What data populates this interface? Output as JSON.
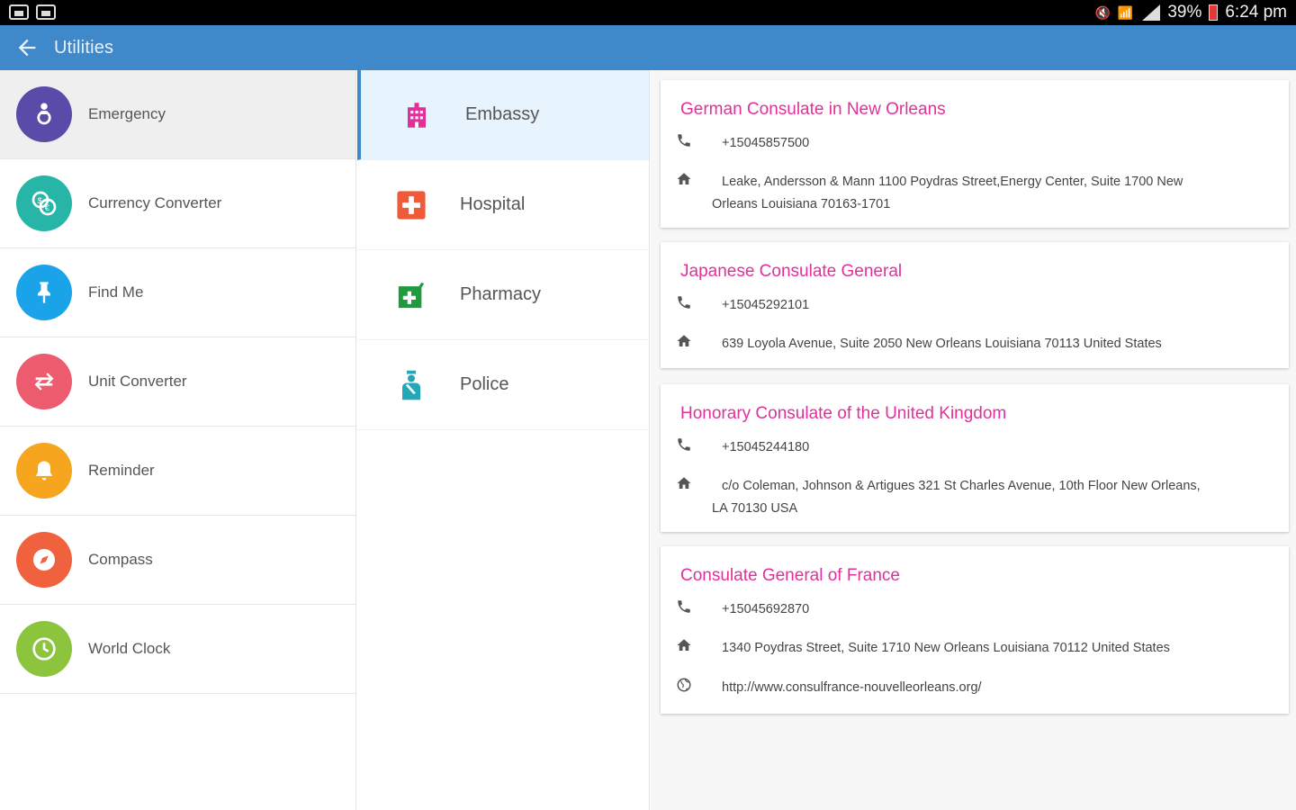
{
  "status_bar": {
    "battery": "39%",
    "time": "6:24 pm"
  },
  "app_bar": {
    "title": "Utilities"
  },
  "categories": [
    {
      "label": "Emergency",
      "icon": "emergency-icon",
      "color": "#5b4ba8"
    },
    {
      "label": "Currency Converter",
      "icon": "currency-icon",
      "color": "#26b5a6"
    },
    {
      "label": "Find Me",
      "icon": "pin-icon",
      "color": "#1aa3e8"
    },
    {
      "label": "Unit Converter",
      "icon": "swap-icon",
      "color": "#ec5b6e"
    },
    {
      "label": "Reminder",
      "icon": "bell-icon",
      "color": "#f6a51f"
    },
    {
      "label": "Compass",
      "icon": "compass-icon",
      "color": "#f0623e"
    },
    {
      "label": "World Clock",
      "icon": "clock-icon",
      "color": "#8cc43e"
    }
  ],
  "subcategories": [
    {
      "label": "Embassy",
      "icon": "building-icon",
      "color": "#e0309a"
    },
    {
      "label": "Hospital",
      "icon": "hospital-cross-icon",
      "color": "#ef5a3b"
    },
    {
      "label": "Pharmacy",
      "icon": "pharmacy-icon",
      "color": "#1f9a3f"
    },
    {
      "label": "Police",
      "icon": "police-icon",
      "color": "#23a8b8"
    }
  ],
  "embassies": [
    {
      "name": "German Consulate in New Orleans",
      "phone": "+15045857500",
      "address_line1": "Leake, Andersson & Mann 1100 Poydras Street,Energy Center, Suite 1700 New",
      "address_line2": "Orleans Louisiana 70163-1701"
    },
    {
      "name": "Japanese Consulate General",
      "phone": "+15045292101",
      "address_line1": "639 Loyola Avenue, Suite 2050 New Orleans Louisiana 70113 United States",
      "address_line2": ""
    },
    {
      "name": "Honorary Consulate of the United Kingdom",
      "phone": "+15045244180",
      "address_line1": "c/o Coleman, Johnson & Artigues 321 St Charles Avenue, 10th Floor New Orleans,",
      "address_line2": "LA 70130 USA"
    },
    {
      "name": "Consulate General of France",
      "phone": "+15045692870",
      "address_line1": "1340 Poydras Street, Suite 1710 New Orleans Louisiana 70112 United States",
      "address_line2": "",
      "website": "http://www.consulfrance-nouvelleorleans.org/"
    }
  ],
  "colors": {
    "app_bar": "#3f88c9",
    "title_pink": "#e0309a",
    "active_sub": "#e8f4fd"
  }
}
